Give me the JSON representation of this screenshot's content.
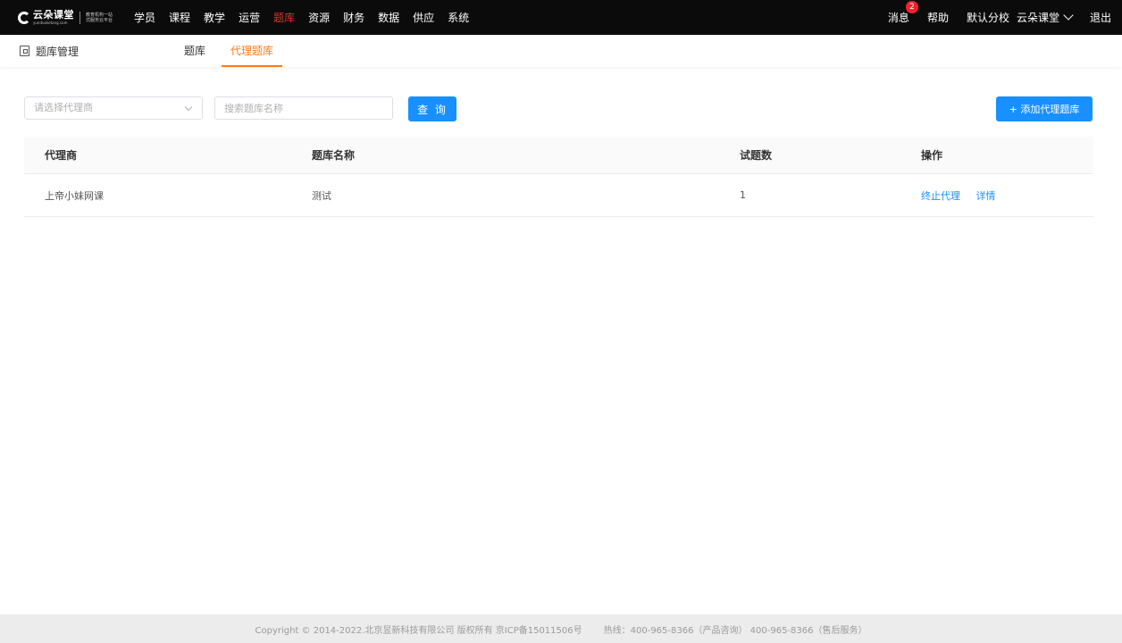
{
  "topbar": {
    "logo": {
      "name": "云朵课堂",
      "url": "yunduoketang.com",
      "slogan_line1": "教育机构一站",
      "slogan_line2": "式服务云平台"
    },
    "nav": [
      "学员",
      "课程",
      "教学",
      "运营",
      "题库",
      "资源",
      "财务",
      "数据",
      "供应",
      "系统"
    ],
    "active_nav_index": 4,
    "right": {
      "messages": "消息",
      "message_count": "2",
      "help": "帮助",
      "branch": "默认分校",
      "org": "云朵课堂",
      "logout": "退出"
    }
  },
  "subheader": {
    "title": "题库管理",
    "tabs": [
      "题库",
      "代理题库"
    ],
    "active_tab_index": 1
  },
  "filters": {
    "agent_select_placeholder": "请选择代理商",
    "search_placeholder": "搜索题库名称",
    "query_button": "查 询",
    "add_button": "+ 添加代理题库"
  },
  "table": {
    "columns": [
      "代理商",
      "题库名称",
      "试题数",
      "操作"
    ],
    "rows": [
      {
        "agent": "上帝小妹网课",
        "bank_name": "测试",
        "count": "1",
        "actions": [
          "终止代理",
          "详情"
        ]
      }
    ]
  },
  "footer": {
    "copyright": "Copyright © 2014-2022.北京昱新科技有限公司 版权所有 京ICP备15011506号",
    "hotline": "热线：400-965-8366（产品咨询） 400-965-8366（售后服务）"
  },
  "colors": {
    "accent": "#1890ff",
    "active_nav": "#e0302d",
    "active_tab": "#ff7a1a",
    "topbar_bg": "#0b0b0b"
  }
}
